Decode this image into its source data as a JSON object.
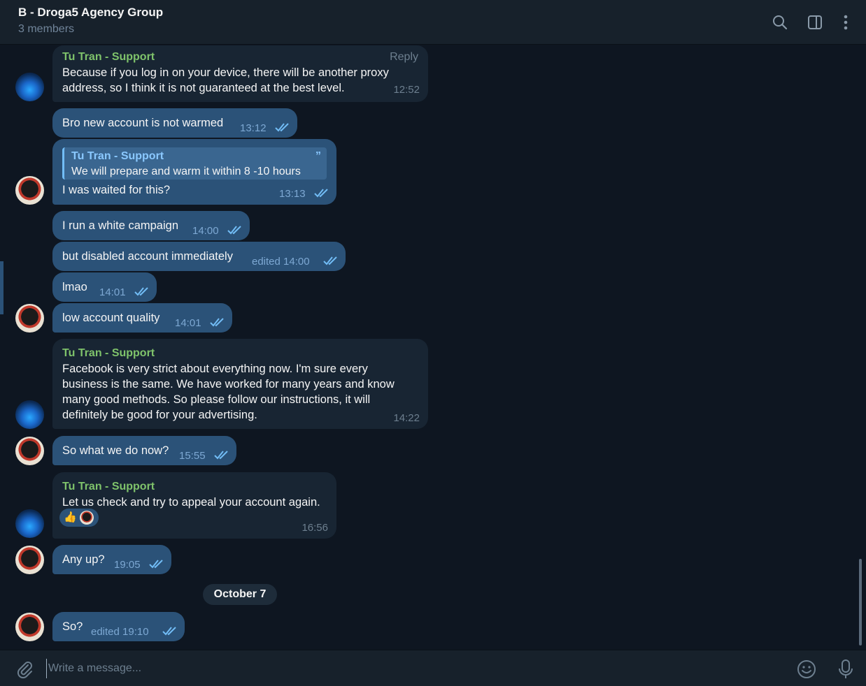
{
  "header": {
    "title": "B - Droga5 Agency Group",
    "subtitle": "3 members"
  },
  "messages": [
    {
      "sender": "Tu Tran - Support",
      "reply_label": "Reply",
      "text_lines": [
        "Because if you log in on your device, there will be another proxy",
        "address, so I think it is not guaranteed at the best level."
      ],
      "time": "12:52"
    },
    {
      "text": "Bro new account is not warmed",
      "time": "13:12"
    },
    {
      "quote_sender": "Tu Tran - Support",
      "quote_text": "We will prepare and warm it within 8 -10 hours",
      "quote_icon": "”",
      "text": "I was waited for this?",
      "time": "13:13"
    },
    {
      "text": "I run a white campaign",
      "time": "14:00"
    },
    {
      "text": "but disabled account immediately",
      "time": "edited 14:00"
    },
    {
      "text": "lmao",
      "time": "14:01"
    },
    {
      "text": "low account quality",
      "time": "14:01"
    },
    {
      "sender": "Tu Tran - Support",
      "text_lines": [
        "Facebook is very strict about everything now. I'm sure every",
        "business is the same. We have worked for many years and know",
        "many good methods. So please follow our instructions, it will",
        "definitely be good for your advertising."
      ],
      "time": "14:22"
    },
    {
      "text": "So what we do now?",
      "time": "15:55"
    },
    {
      "sender": "Tu Tran - Support",
      "text": "Let us check and try to appeal your account again.",
      "reaction": "👍",
      "time": "16:56"
    },
    {
      "text": "Any up?",
      "time": "19:05"
    },
    {
      "text": "So?",
      "time": "edited 19:10"
    }
  ],
  "date_separator": "October 7",
  "input": {
    "placeholder": "Write a message..."
  },
  "colors": {
    "background": "#0e1621",
    "incoming_bubble": "#182533",
    "outgoing_bubble": "#2b5278",
    "sender_name": "#7fc36b",
    "accent": "#72bdf6"
  },
  "icons": [
    "search-icon",
    "sidebar-toggle-icon",
    "more-vertical-icon",
    "double-check-icon",
    "paperclip-icon",
    "emoji-icon",
    "microphone-icon"
  ]
}
